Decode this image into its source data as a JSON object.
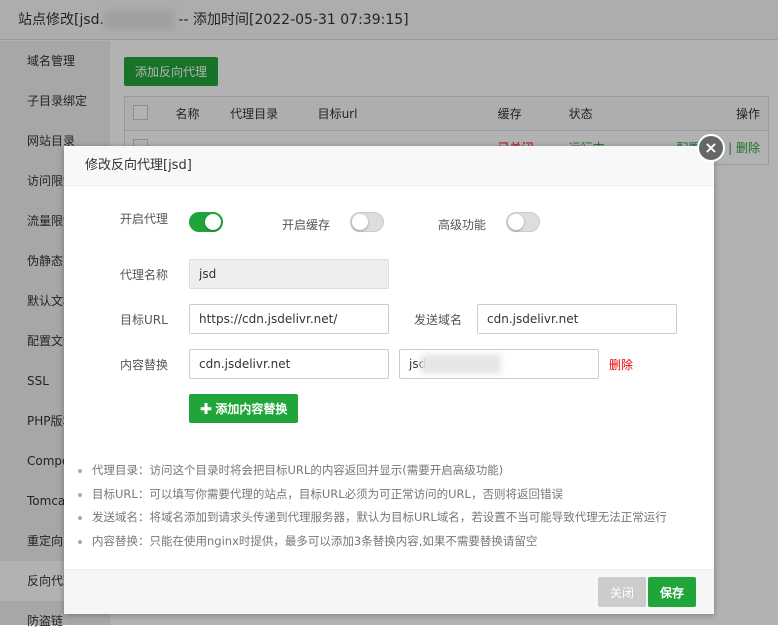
{
  "background": {
    "title_prefix": "站点修改[jsd.",
    "title_suffix": " -- 添加时间[2022-05-31 07:39:15]",
    "sidebar": [
      "域名管理",
      "子目录绑定",
      "网站目录",
      "访问限制",
      "流量限制",
      "伪静态",
      "默认文档",
      "配置文件",
      "SSL",
      "PHP版本",
      "Composer",
      "Tomcat",
      "重定向",
      "反向代理",
      "防盗链"
    ],
    "add_button": "添加反向代理",
    "table_headers": [
      "名称",
      "代理目录",
      "目标url",
      "缓存",
      "状态",
      "操作"
    ],
    "row": {
      "cache": "已关闭",
      "status": "运行中",
      "config": "配置文件",
      "delete": "删除"
    }
  },
  "modal": {
    "title": "修改反向代理[jsd]",
    "enable_proxy_label": "开启代理",
    "enable_proxy": true,
    "enable_cache_label": "开启缓存",
    "enable_cache": false,
    "advanced_label": "高级功能",
    "advanced": false,
    "name_label": "代理名称",
    "name_value": "jsd",
    "target_url_label": "目标URL",
    "target_url_value": "https://cdn.jsdelivr.net/",
    "send_domain_label": "发送域名",
    "send_domain_value": "cdn.jsdelivr.net",
    "replace_label": "内容替换",
    "replace_from": "cdn.jsdelivr.net",
    "replace_to": "jsd",
    "replace_delete": "删除",
    "add_replace_button": "添加内容替换",
    "tips": [
      "代理目录：访问这个目录时将会把目标URL的内容返回并显示(需要开启高级功能)",
      "目标URL：可以填写你需要代理的站点，目标URL必须为可正常访问的URL，否则将返回错误",
      "发送域名：将域名添加到请求头传递到代理服务器，默认为目标URL域名，若设置不当可能导致代理无法正常运行",
      "内容替换：只能在使用nginx时提供，最多可以添加3条替换内容,如果不需要替换请留空"
    ],
    "close_button": "关闭",
    "save_button": "保存"
  }
}
